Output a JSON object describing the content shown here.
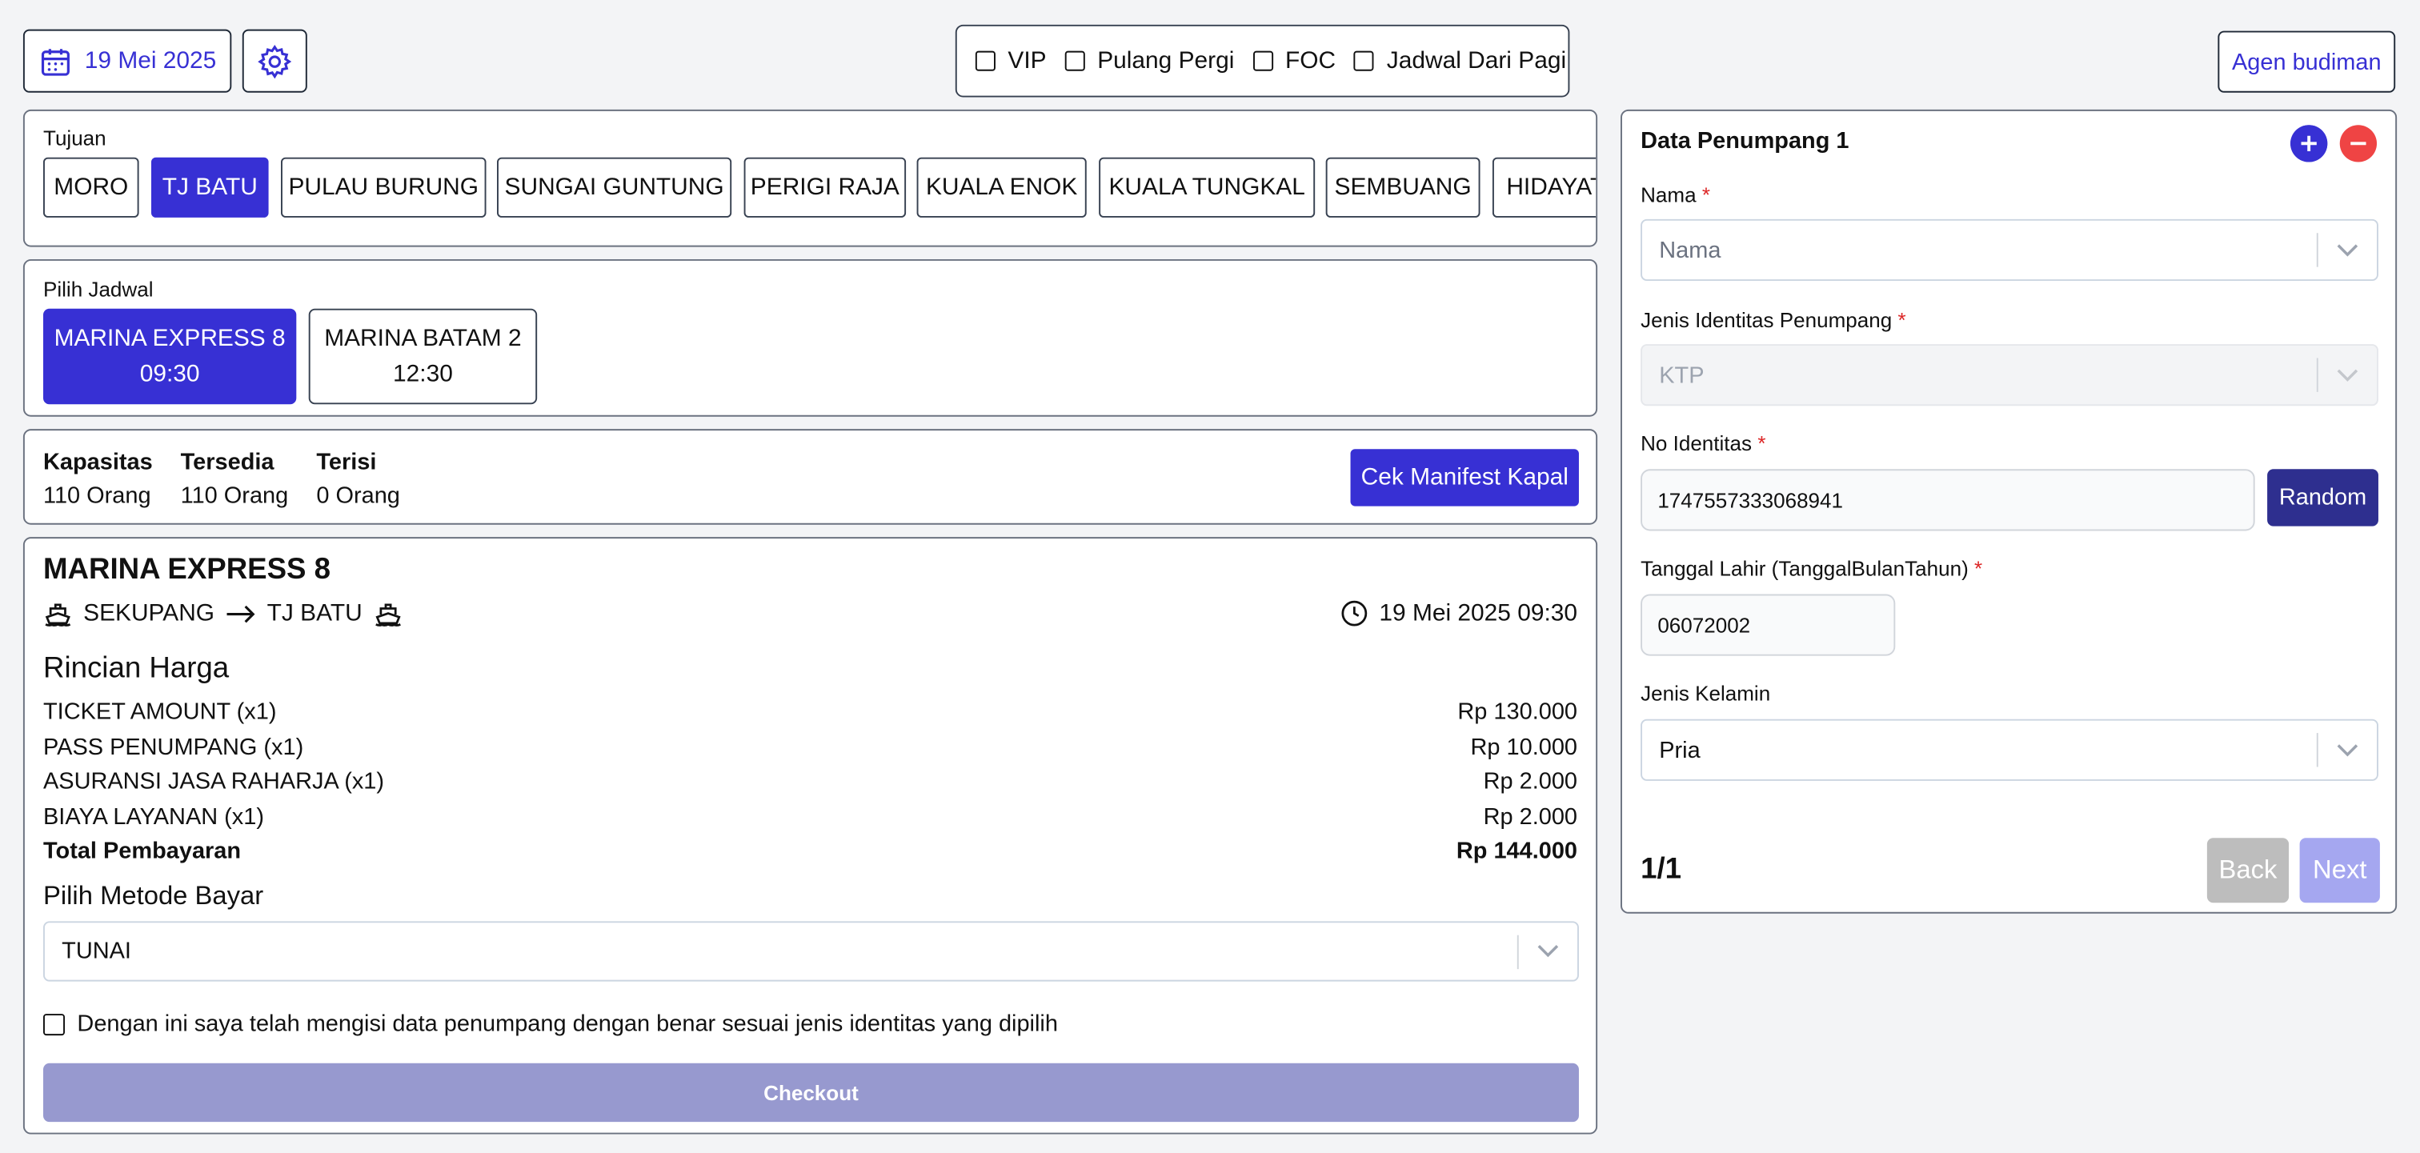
{
  "header": {
    "date": "19 Mei 2025",
    "filters": [
      "VIP",
      "Pulang Pergi",
      "FOC",
      "Jadwal Dari Pagi"
    ],
    "agent": "Agen budiman"
  },
  "destinations": {
    "label": "Tujuan",
    "items": [
      "MORO",
      "TJ BATU",
      "PULAU BURUNG",
      "SUNGAI GUNTUNG",
      "PERIGI RAJA",
      "KUALA ENOK",
      "KUALA TUNGKAL",
      "SEMBUANG",
      "HIDAYAT"
    ],
    "selected": "TJ BATU"
  },
  "schedule": {
    "label": "Pilih Jadwal",
    "items": [
      {
        "name": "MARINA EXPRESS 8",
        "time": "09:30"
      },
      {
        "name": "MARINA BATAM 2",
        "time": "12:30"
      }
    ]
  },
  "capacity": {
    "kapasitas_label": "Kapasitas",
    "kapasitas": "110 Orang",
    "tersedia_label": "Tersedia",
    "tersedia": "110 Orang",
    "terisi_label": "Terisi",
    "terisi": "0 Orang",
    "manifest_button": "Cek Manifest Kapal"
  },
  "trip": {
    "ship": "MARINA EXPRESS 8",
    "from": "SEKUPANG",
    "to": "TJ BATU",
    "datetime": "19 Mei 2025 09:30",
    "price_title": "Rincian Harga",
    "lines": [
      {
        "label": "TICKET AMOUNT (x1)",
        "amount": "Rp 130.000"
      },
      {
        "label": "PASS PENUMPANG (x1)",
        "amount": "Rp 10.000"
      },
      {
        "label": "ASURANSI JASA RAHARJA (x1)",
        "amount": "Rp 2.000"
      },
      {
        "label": "BIAYA LAYANAN (x1)",
        "amount": "Rp 2.000"
      }
    ],
    "total_label": "Total Pembayaran",
    "total": "Rp 144.000",
    "payment_title": "Pilih Metode Bayar",
    "payment_value": "TUNAI",
    "agreement": "Dengan ini saya telah mengisi data penumpang dengan benar sesuai jenis identitas yang dipilih",
    "checkout": "Checkout"
  },
  "passenger": {
    "title": "Data Penumpang 1",
    "nama_label": "Nama",
    "nama_placeholder": "Nama",
    "id_type_label": "Jenis Identitas Penumpang",
    "id_type_value": "KTP",
    "id_no_label": "No Identitas",
    "id_no_value": "1747557333068941",
    "random_button": "Random",
    "dob_label": "Tanggal Lahir (TanggalBulanTahun)",
    "dob_value": "06072002",
    "gender_label": "Jenis Kelamin",
    "gender_value": "Pria",
    "page": "1/1",
    "back": "Back",
    "next": "Next"
  },
  "colors": {
    "primary": "#3730d4",
    "navy": "#2e2f8f",
    "disabled": "#9799cf",
    "danger": "#ef4444",
    "required": "#dc2626"
  },
  "icons": [
    "calendar-icon",
    "gear-icon",
    "ship-icon",
    "arrow-right-icon",
    "clock-icon",
    "plus-icon",
    "minus-icon",
    "chevron-down-icon"
  ]
}
